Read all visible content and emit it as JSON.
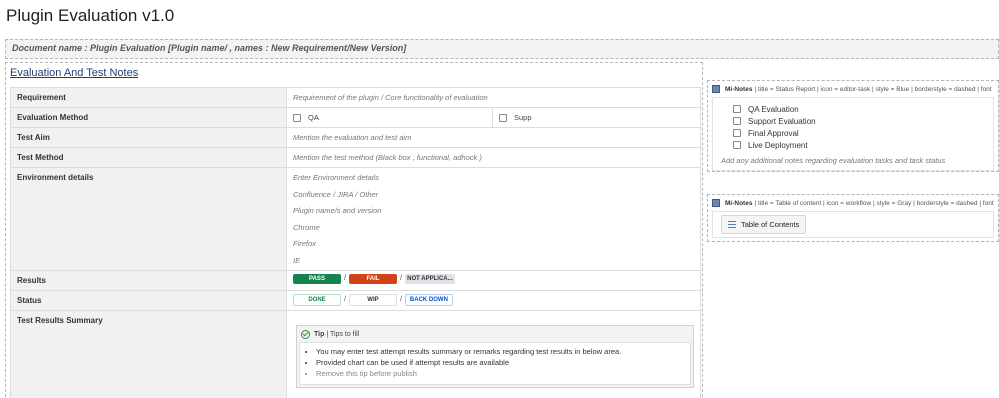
{
  "page": {
    "title": "Plugin Evaluation v1.0"
  },
  "document_bar": {
    "text": "Document name : Plugin Evaluation [Plugin name/ , names : New Requirement/New Version]"
  },
  "main": {
    "section_title": "Evaluation And Test Notes",
    "rows": {
      "requirement": {
        "label": "Requirement",
        "value": "Requirement of the plugin / Core functionality of evaluation"
      },
      "evaluation_method": {
        "label": "Evaluation Method",
        "option1": "QA",
        "option2": "Supp"
      },
      "test_aim": {
        "label": "Test Aim",
        "value": "Mention the evaluation and test aim"
      },
      "test_method": {
        "label": "Test Method",
        "value": "Mention the test method (Black box , functional, adhock )"
      },
      "environment": {
        "label": "Environment details",
        "lines": [
          "Enter Environment details",
          "Confluence / JIRA / Other",
          "Plugin name/s and version",
          "Chrome",
          "Firefox",
          "IE"
        ]
      },
      "results": {
        "label": "Results",
        "pass": "PASS",
        "fail": "FAIL",
        "na": "NOT APPLICA...",
        "separator": "/"
      },
      "status": {
        "label": "Status",
        "done": "DONE",
        "wip": "WIP",
        "back_down": "BACK DOWN",
        "separator": "/"
      },
      "summary": {
        "label": "Test Results Summary",
        "tip_title": "Tip",
        "tip_subtitle": "| Tips to fill",
        "tip_items": [
          "You may enter test attempt results summary or remarks regarding test results in below area.",
          "Provided chart can be used if attempt results are available",
          "Remove this tip before publish"
        ]
      }
    }
  },
  "status_panel": {
    "macro_name": "Mi-Notes",
    "macro_params": "| title = Status Report | icon = editor-task | style = Blue | borderstyle = dashed | font",
    "items": [
      "QA Evaluation",
      "Support Evaluation",
      "Final Approval",
      "Live Deployment"
    ],
    "note": "Add any additional notes regarding evaluation tasks and task status"
  },
  "toc_panel": {
    "macro_name": "Mi-Notes",
    "macro_params": "| title = Table of content | icon = workflow | style = Gray | borderstyle = dashed | font",
    "button_label": "Table of Contents"
  },
  "colors": {
    "pass": "#14854f",
    "fail": "#d04417",
    "na_bg": "#dfe1e6",
    "done": "#14854f",
    "back_down": "#0052cc",
    "link": "#1f3e73"
  }
}
